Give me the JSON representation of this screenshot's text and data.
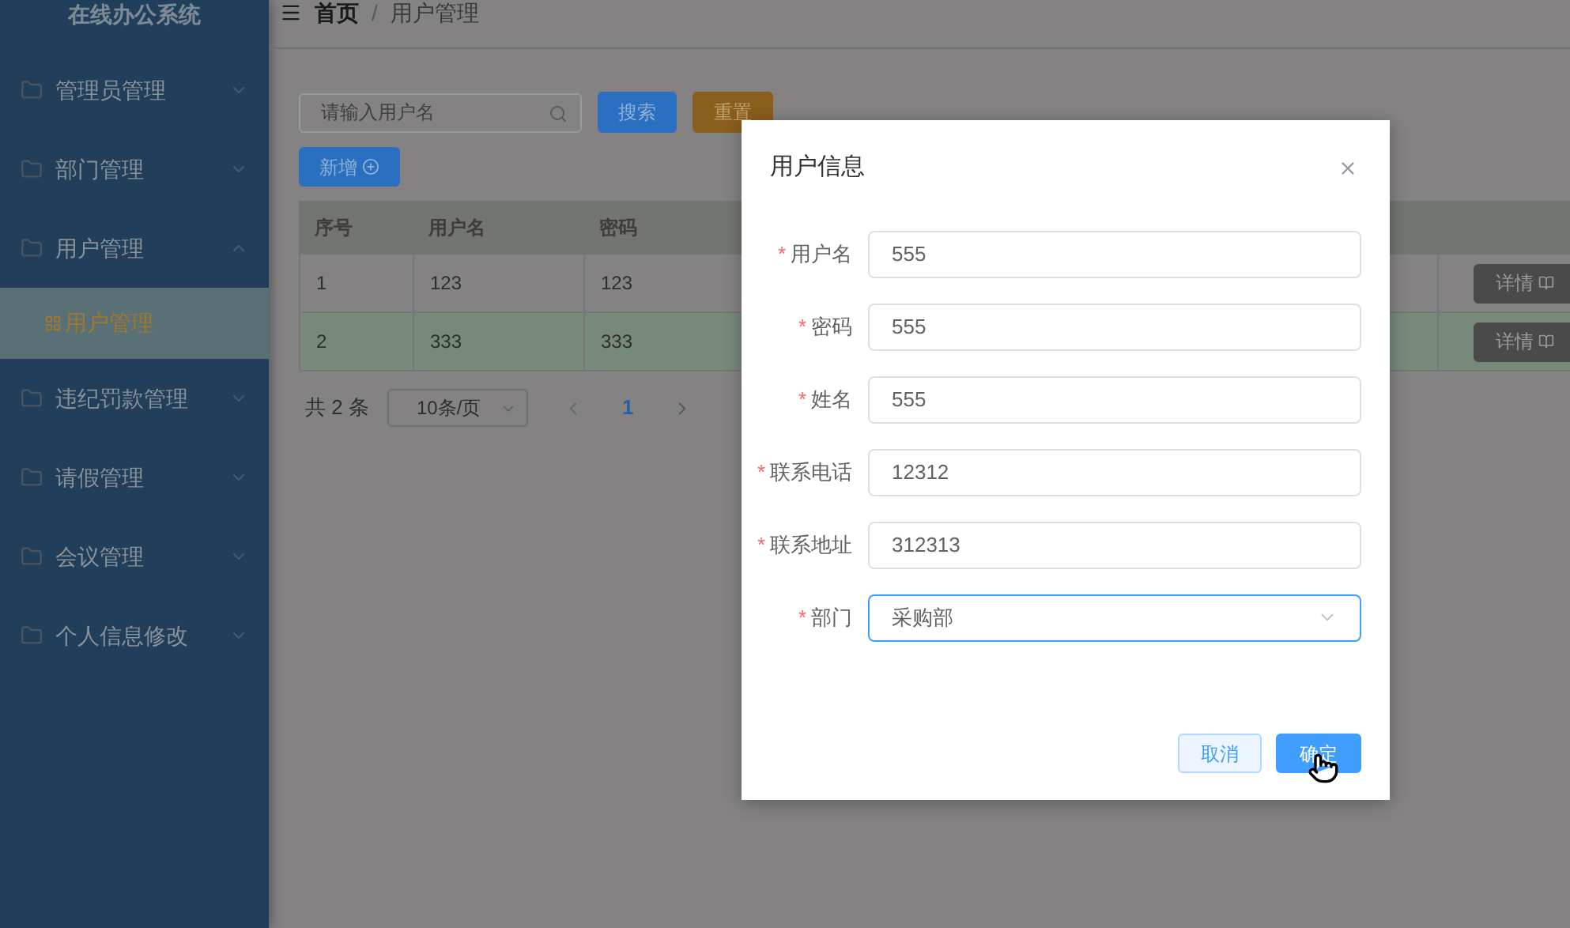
{
  "app_title": "在线办公系统",
  "breadcrumb": [
    "首页",
    "用户管理"
  ],
  "breadcrumb_separator": "/",
  "sidebar": {
    "items": [
      {
        "label": "管理员管理",
        "expanded": false
      },
      {
        "label": "部门管理",
        "expanded": false
      },
      {
        "label": "用户管理",
        "expanded": true,
        "children": [
          {
            "label": "用户管理",
            "selected": true
          }
        ]
      },
      {
        "label": "违纪罚款管理",
        "expanded": false
      },
      {
        "label": "请假管理",
        "expanded": false
      },
      {
        "label": "会议管理",
        "expanded": false
      },
      {
        "label": "个人信息修改",
        "expanded": false
      }
    ]
  },
  "search": {
    "placeholder": "请输入用户名"
  },
  "buttons": {
    "search": "搜索",
    "reset": "重置",
    "add": "新增"
  },
  "table": {
    "columns": [
      "序号",
      "用户名",
      "密码"
    ],
    "rows": [
      {
        "cells": [
          "1",
          "123",
          "123"
        ],
        "highlighted": false,
        "action": "详情"
      },
      {
        "cells": [
          "2",
          "333",
          "333"
        ],
        "highlighted": true,
        "action": "详情"
      }
    ]
  },
  "pagination": {
    "total": "共 2 条",
    "page_size": "10条/页",
    "current_page": "1"
  },
  "dialog": {
    "title": "用户信息",
    "fields": [
      {
        "label": "用户名",
        "value": "555",
        "required_mark": "*",
        "kind": "input"
      },
      {
        "label": "密码",
        "value": "555",
        "required_mark": "*",
        "kind": "input"
      },
      {
        "label": "姓名",
        "value": "555",
        "required_mark": "*",
        "kind": "input"
      },
      {
        "label": "联系电话",
        "value": "12312",
        "required_mark": "*",
        "kind": "input"
      },
      {
        "label": "联系地址",
        "value": "312313",
        "required_mark": "*",
        "kind": "input"
      },
      {
        "label": "部门",
        "value": "采购部",
        "required_mark": "*",
        "kind": "select"
      }
    ],
    "cancel": "取消",
    "confirm": "确定"
  }
}
